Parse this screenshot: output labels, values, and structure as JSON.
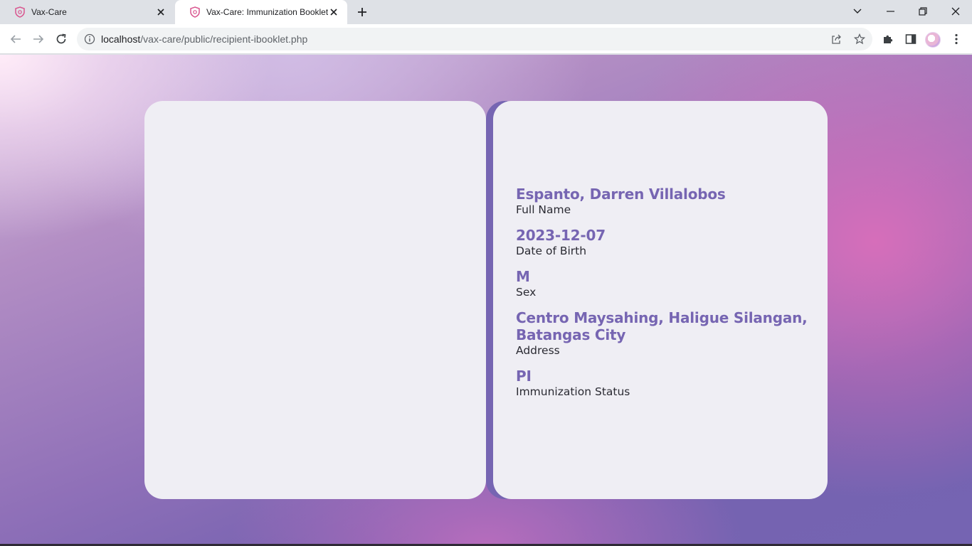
{
  "browser": {
    "tabs": [
      {
        "title": "Vax-Care",
        "active": false
      },
      {
        "title": "Vax-Care: Immunization Booklet",
        "active": true
      }
    ],
    "url_host": "localhost",
    "url_path": "/vax-care/public/recipient-ibooklet.php"
  },
  "recipient": {
    "fields": [
      {
        "value": "Espanto, Darren Villalobos",
        "label": "Full Name"
      },
      {
        "value": "2023-12-07",
        "label": "Date of Birth"
      },
      {
        "value": "M",
        "label": "Sex"
      },
      {
        "value": "Centro Maysahing, Haligue Silangan, Batangas City",
        "label": "Address"
      },
      {
        "value": "PI",
        "label": "Immunization Status"
      }
    ]
  },
  "colors": {
    "accent": "#7665b2",
    "page_bg": "#efeef4",
    "favicon": "#d9568f"
  }
}
